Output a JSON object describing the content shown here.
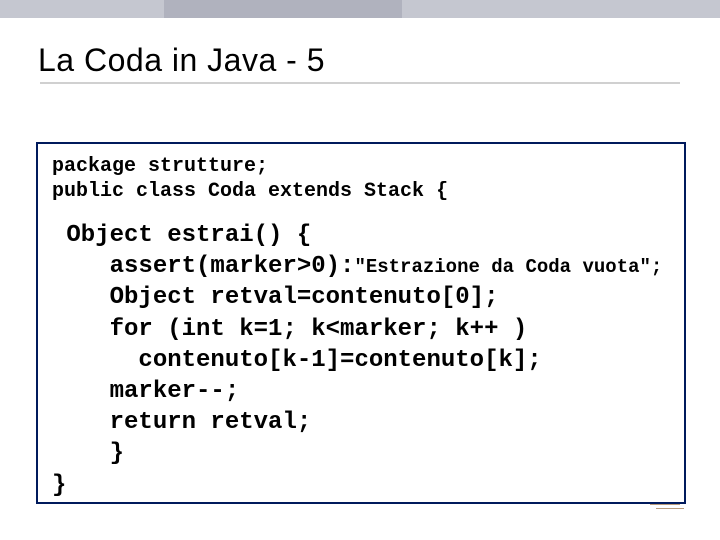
{
  "title": "La Coda in Java - 5",
  "code": {
    "line1": "package strutture;",
    "line2": "public class Coda extends Stack {",
    "line3": " Object estrai() {",
    "line4a": "    assert(marker>0):",
    "line4b": "\"Estrazione da Coda vuota\";",
    "line5": "    Object retval=contenuto[0];",
    "line6": "    for (int k=1; k<marker; k++ )",
    "line7": "      contenuto[k-1]=contenuto[k];",
    "line8": "    marker--;",
    "line9": "    return retval;",
    "line10": "    }",
    "line11": "}"
  }
}
